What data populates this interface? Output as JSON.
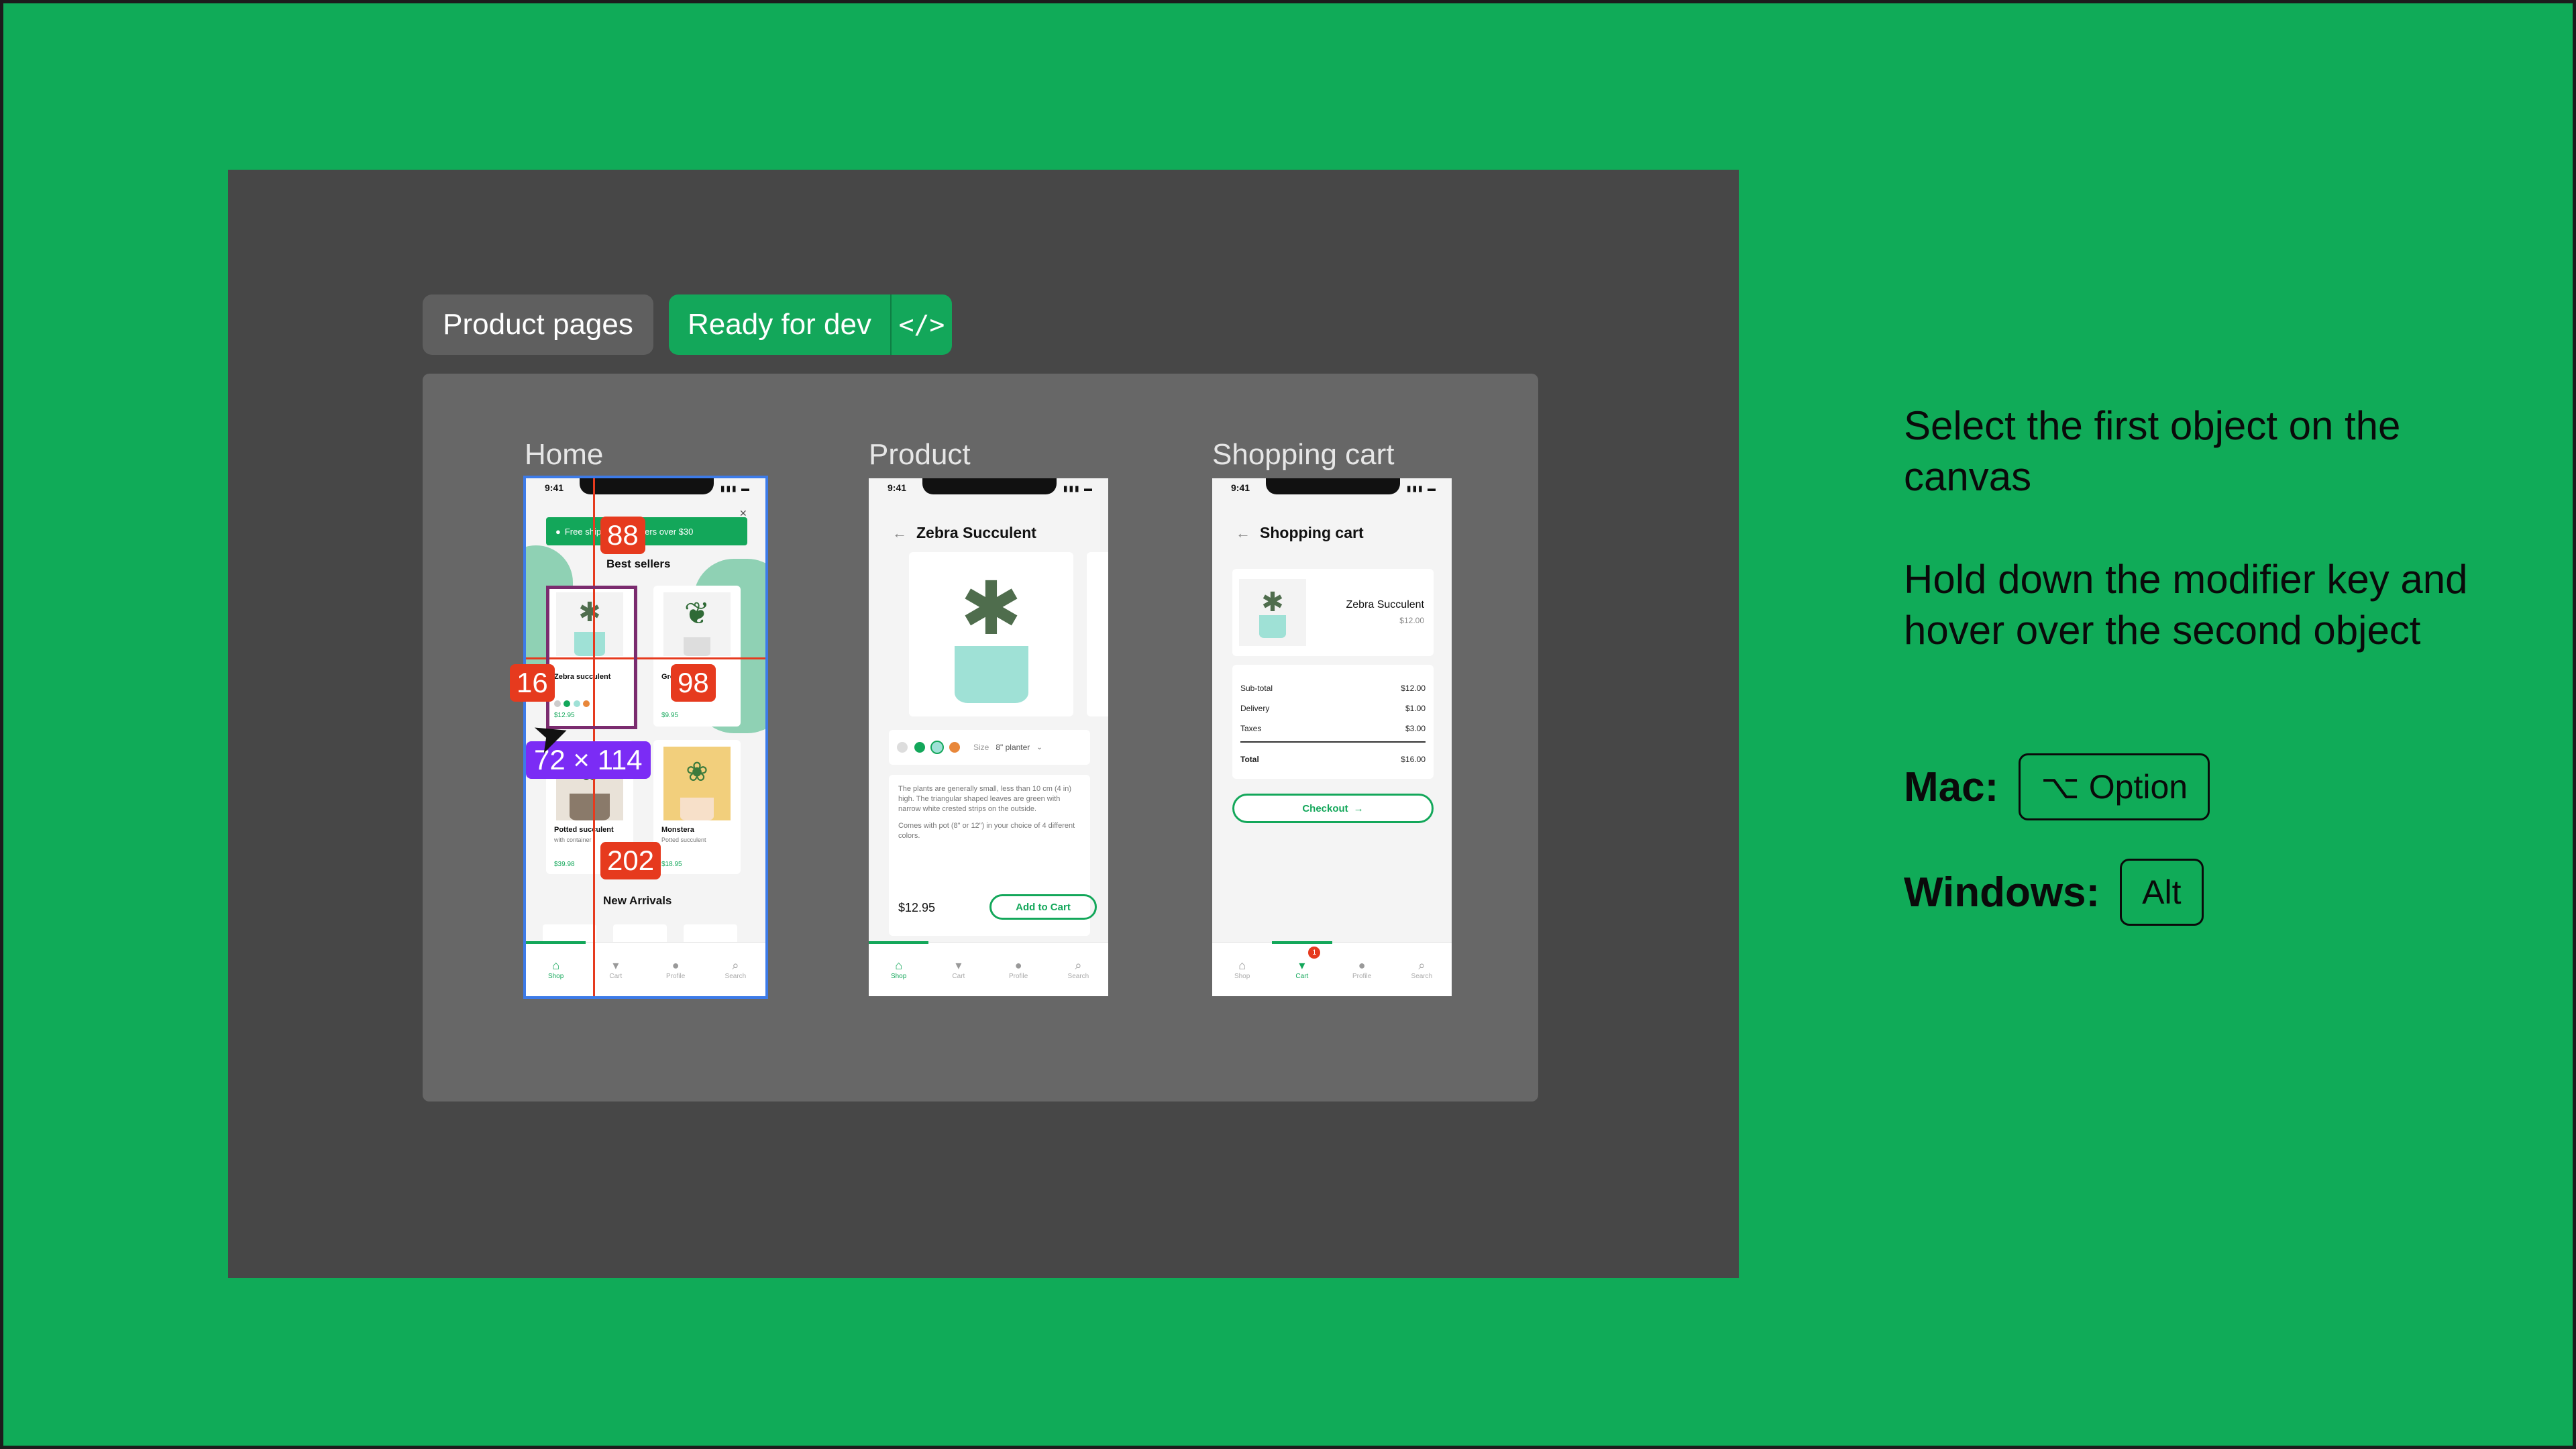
{
  "colors": {
    "accent": "#13a75a",
    "background": "#10ab58",
    "canvas": "#474747",
    "measure": "#e63a1e",
    "dimension": "#7b2cf5"
  },
  "chips": {
    "page_title": "Product pages",
    "status": "Ready for dev",
    "code_icon": "</>"
  },
  "frames": {
    "home_label": "Home",
    "product_label": "Product",
    "cart_label": "Shopping cart"
  },
  "status_bar": {
    "time": "9:41"
  },
  "home": {
    "banner": "Free shipping on orders over $30",
    "best_sellers": "Best sellers",
    "items": [
      {
        "name": "Zebra succulent",
        "price": "$12.95"
      },
      {
        "name": "Green leaves",
        "price": "$9.95"
      },
      {
        "name": "Potted succulent",
        "sub": "with container",
        "price": "$39.98"
      },
      {
        "name": "Monstera",
        "sub": "Potted succulent",
        "price": "$18.95"
      }
    ],
    "new_arrivals": "New Arrivals"
  },
  "measurements": {
    "top": "88",
    "left": "16",
    "right": "98",
    "bottom": "202",
    "dims": "72 × 114"
  },
  "product": {
    "title": "Zebra Succulent",
    "size_label": "Size",
    "size_value": "8\" planter",
    "description": "The plants are generally small, less than 10 cm (4 in) high. The triangular shaped leaves are green with narrow white crested strips on the outside.",
    "description2": "Comes with pot (8\" or 12\") in your choice of 4 different colors.",
    "price": "$12.95",
    "add_to_cart": "Add to Cart"
  },
  "cart": {
    "title": "Shopping cart",
    "item_name": "Zebra Succulent",
    "item_price": "$12.00",
    "subtotal_label": "Sub-total",
    "subtotal": "$12.00",
    "delivery_label": "Delivery",
    "delivery": "$1.00",
    "taxes_label": "Taxes",
    "taxes": "$3.00",
    "total_label": "Total",
    "total": "$16.00",
    "checkout": "Checkout",
    "badge": "1"
  },
  "tabs": [
    "Shop",
    "Cart",
    "Profile",
    "Search"
  ],
  "instructions": {
    "step1": "Select the first object on the canvas",
    "step2": "Hold down the modifier key and hover over the second object",
    "mac_label": "Mac:",
    "mac_key": "⌥ Option",
    "win_label": "Windows:",
    "win_key": "Alt"
  }
}
